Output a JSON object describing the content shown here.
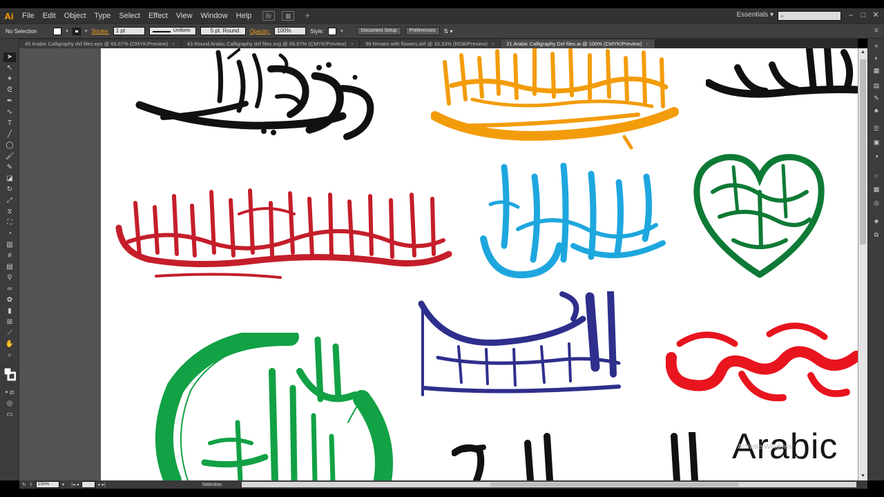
{
  "app": {
    "logo": "Ai",
    "menus": [
      "File",
      "Edit",
      "Object",
      "Type",
      "Select",
      "Effect",
      "View",
      "Window",
      "Help"
    ],
    "workspace": "Essentials"
  },
  "control_bar": {
    "selection_state": "No Selection",
    "stroke_label": "Stroke:",
    "stroke_weight": "1 pt",
    "stroke_profile": "Uniform",
    "brush": "5 pt. Round",
    "opacity_label": "Opacity:",
    "opacity": "100%",
    "style_label": "Style:",
    "document_setup": "Document Setup",
    "preferences": "Preferences"
  },
  "tabs": [
    {
      "label": "45 Arabic Calligraphy dxf files.eps @ 66.67% (CMYK/Preview)",
      "active": false
    },
    {
      "label": "43 Round Arabic Calligraphy dxf files.svg @ 66.67% (CMYK/Preview)",
      "active": false
    },
    {
      "label": "99 Nmaes with flowers.dxf @ 33.33% (RGB/Preview)",
      "active": false
    },
    {
      "label": "21 Arabic Calligraphy Dxf files.ai @ 100% (CMYK/Preview)",
      "active": true
    }
  ],
  "status": {
    "zoom": "100%",
    "tool": "Selection"
  },
  "canvas": {
    "latin_label": "Arabic",
    "watermark": "Activate Windows"
  },
  "colors": {
    "black_calligraphy": "#111111",
    "orange_calligraphy": "#f39c0b",
    "red_calligraphy": "#c41e2a",
    "blue_calligraphy": "#1ea7de",
    "green_heart": "#0e7a35",
    "navy_calligraphy": "#2e2f8c",
    "bright_red": "#e8141e",
    "green_round": "#12a145"
  }
}
